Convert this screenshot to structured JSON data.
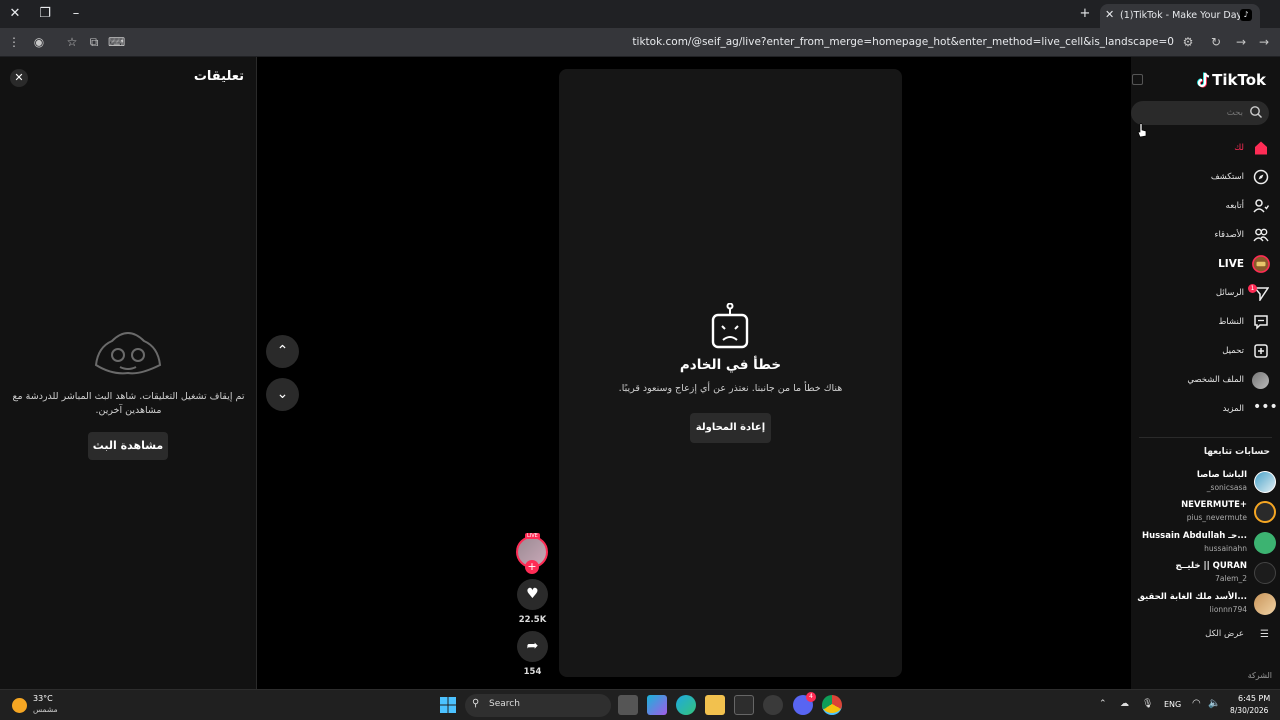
{
  "browser": {
    "tab_title": "(1)TikTok - Make Your Day",
    "url": "tiktok.com/@seif_ag/live?enter_from_merge=homepage_hot&enter_method=live_cell&is_landscape=0"
  },
  "comments": {
    "title": "تعليقات",
    "message": "تم إيقاف تشغيل التعليقات. شاهد البث المباشر للدردشة مع مشاهدين آخرين.",
    "watch_button": "مشاهدة البث"
  },
  "video": {
    "error_title": "خطأ في الخادم",
    "error_message": "هناك خطأ ما من جانبنا. نعتذر عن أي إزعاج وسنعود قريبًا.",
    "retry_button": "إعادة المحاولة",
    "live_badge": "LIVE",
    "likes_count": "22.5K",
    "shares_count": "154"
  },
  "sidebar": {
    "logo": "TikTok",
    "search_placeholder": "بحث",
    "nav": [
      {
        "label": "لك",
        "icon": "home-icon"
      },
      {
        "label": "استكشف",
        "icon": "compass-icon"
      },
      {
        "label": "أتابعه",
        "icon": "user-follow-icon"
      },
      {
        "label": "الأصدقاء",
        "icon": "friends-icon"
      },
      {
        "label": "LIVE",
        "icon": "live-icon"
      },
      {
        "label": "الرسائل",
        "icon": "message-icon",
        "badge": "1"
      },
      {
        "label": "النشاط",
        "icon": "activity-icon"
      },
      {
        "label": "تحميل",
        "icon": "upload-icon"
      },
      {
        "label": "الملف الشخصي",
        "icon": "profile-avatar"
      },
      {
        "label": "المزيد",
        "icon": "more-icon"
      }
    ],
    "following_title": "حسابات تتابعها",
    "accounts": [
      {
        "name": "الباشا صاصا",
        "handle": "_sonicsasa"
      },
      {
        "name": "NEVERMUTE+",
        "handle": "pius_nevermute"
      },
      {
        "name": "Hussain Abdullah حـ...",
        "handle": "hussainahn"
      },
      {
        "name": "خليــج || QURAN",
        "handle": "7alem_2"
      },
      {
        "name": "الأسد ملك الغابة الحقيق...",
        "handle": "lionnn794"
      }
    ],
    "see_all": "عرض الكل",
    "company": "الشركة"
  },
  "taskbar": {
    "temperature": "33°C",
    "weather": "مشمس",
    "search_label": "Search",
    "language": "ENG",
    "time": "6:45 PM",
    "date": "8/30/2026",
    "discord_badge": "4"
  },
  "colors": {
    "accent": "#fe2c55",
    "background": "#000000",
    "panel": "#121212"
  }
}
